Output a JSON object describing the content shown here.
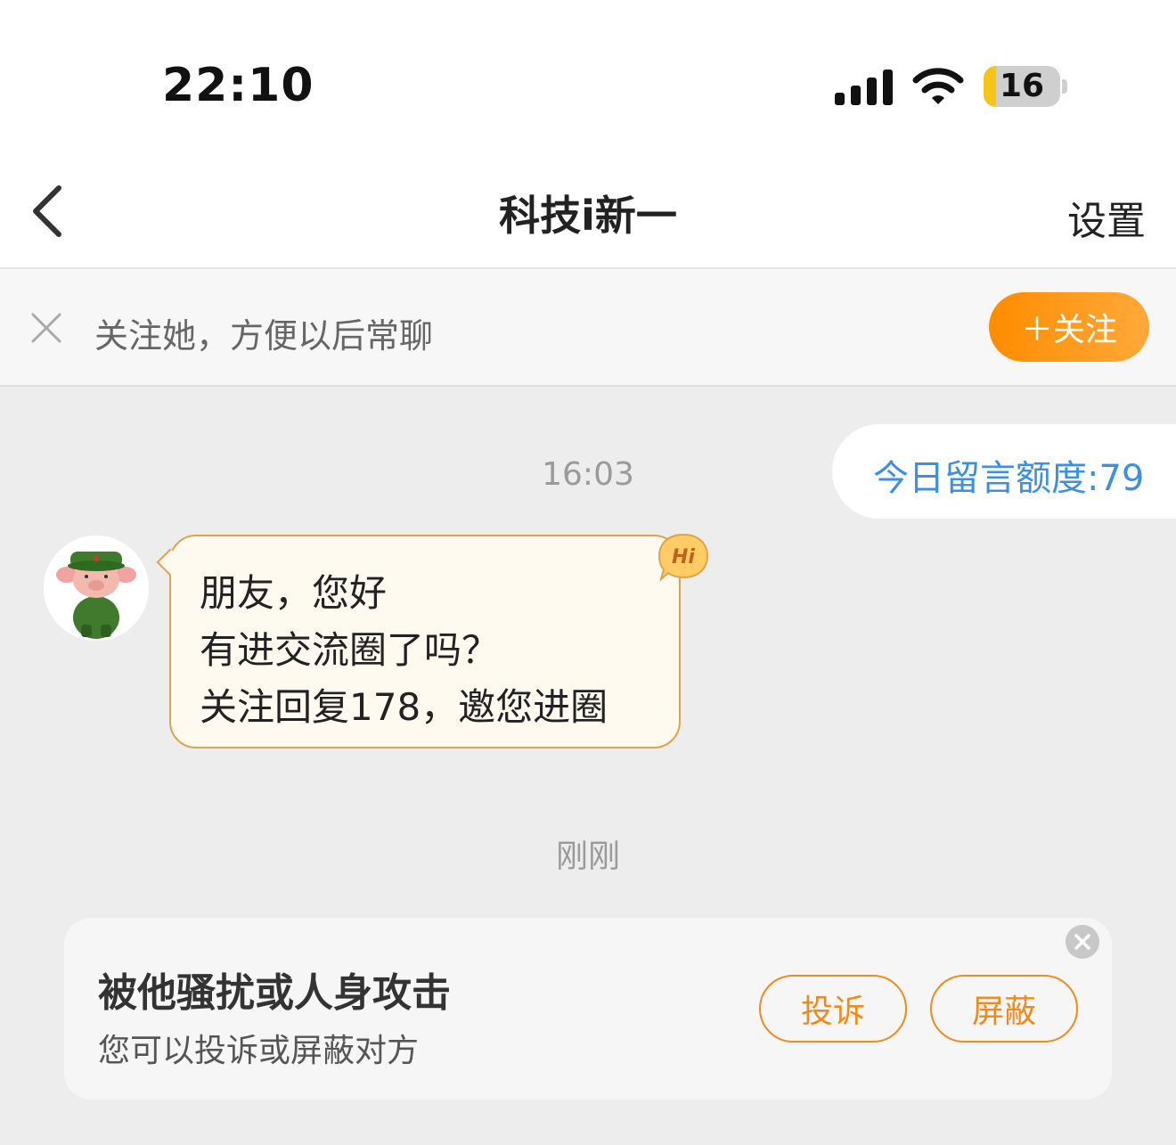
{
  "status_bar": {
    "time": "22:10",
    "battery": "16",
    "battery_level": 0.16,
    "icons": [
      "signal-icon",
      "wifi-icon",
      "battery-icon"
    ]
  },
  "nav": {
    "title": "科技i新一",
    "settings": "设置",
    "back_icon": "chevron-left-icon"
  },
  "follow_bar": {
    "text": "关注她，方便以后常聊",
    "button": "＋关注",
    "close_icon": "close-icon"
  },
  "chat": {
    "timestamp_1": "16:03",
    "quota": "今日留言额度:79",
    "message_lines": [
      "朋友，您好",
      "有进交流圈了吗？",
      "关注回复178，邀您进圈"
    ],
    "hi_badge": "Hi",
    "timestamp_2": "刚刚"
  },
  "safety_card": {
    "title": "被他骚扰或人身攻击",
    "subtitle": "您可以投诉或屏蔽对方",
    "report": "投诉",
    "block": "屏蔽"
  },
  "colors": {
    "accent": "#ff8c00",
    "link": "#3d8fe0",
    "bubble_border": "#e0a24a",
    "background": "#ededed"
  }
}
